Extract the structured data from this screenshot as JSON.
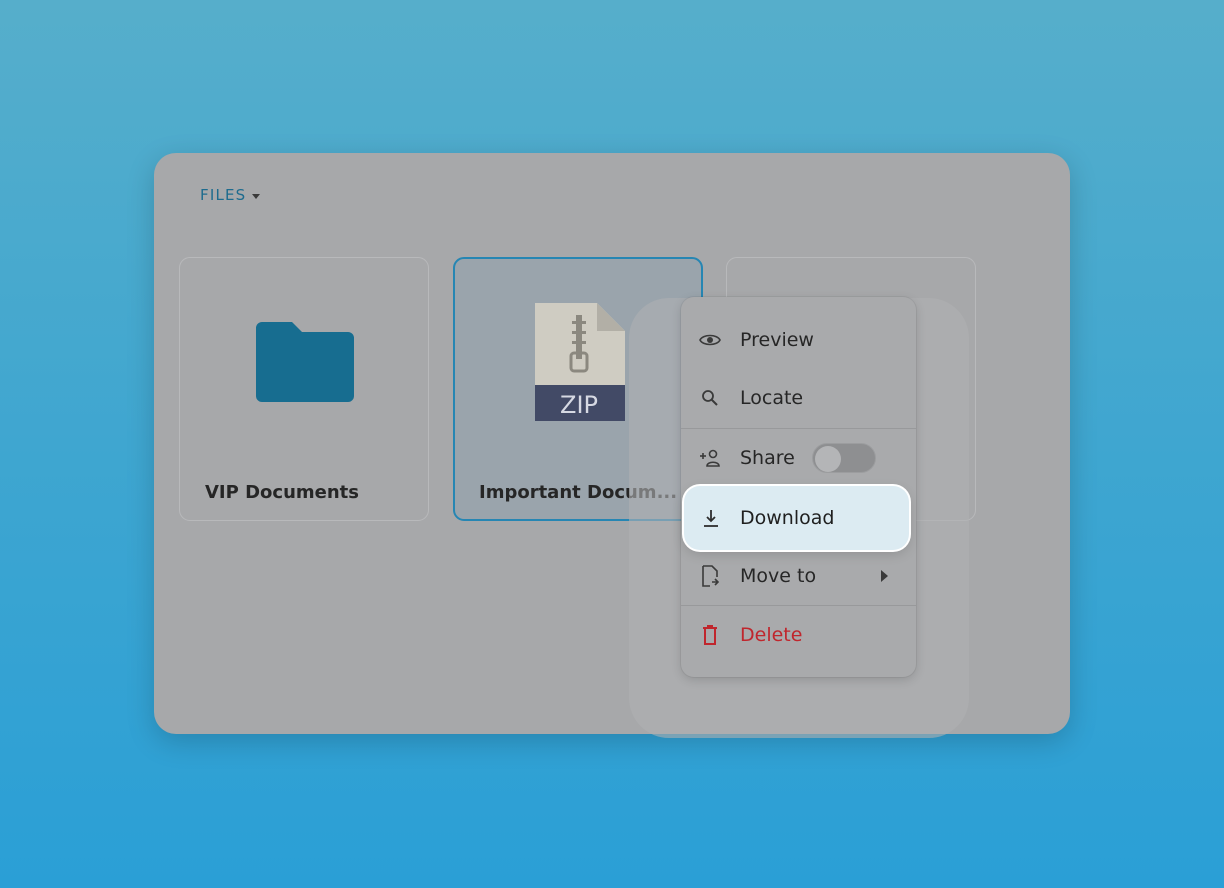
{
  "header": {
    "files_label": "FILES"
  },
  "files": [
    {
      "name": "VIP Documents",
      "icon": "folder-icon"
    },
    {
      "name": "Important Docum...",
      "icon": "zip-file-icon",
      "badge": "ZIP"
    },
    {
      "name": "",
      "icon": ""
    }
  ],
  "context_menu": {
    "preview": "Preview",
    "locate": "Locate",
    "share": "Share",
    "share_enabled": false,
    "download": "Download",
    "move_to": "Move to",
    "delete": "Delete"
  },
  "colors": {
    "accent": "#1d6b8e",
    "folder": "#176d90",
    "delete": "#c0262d",
    "highlight": "#dcebf2"
  }
}
